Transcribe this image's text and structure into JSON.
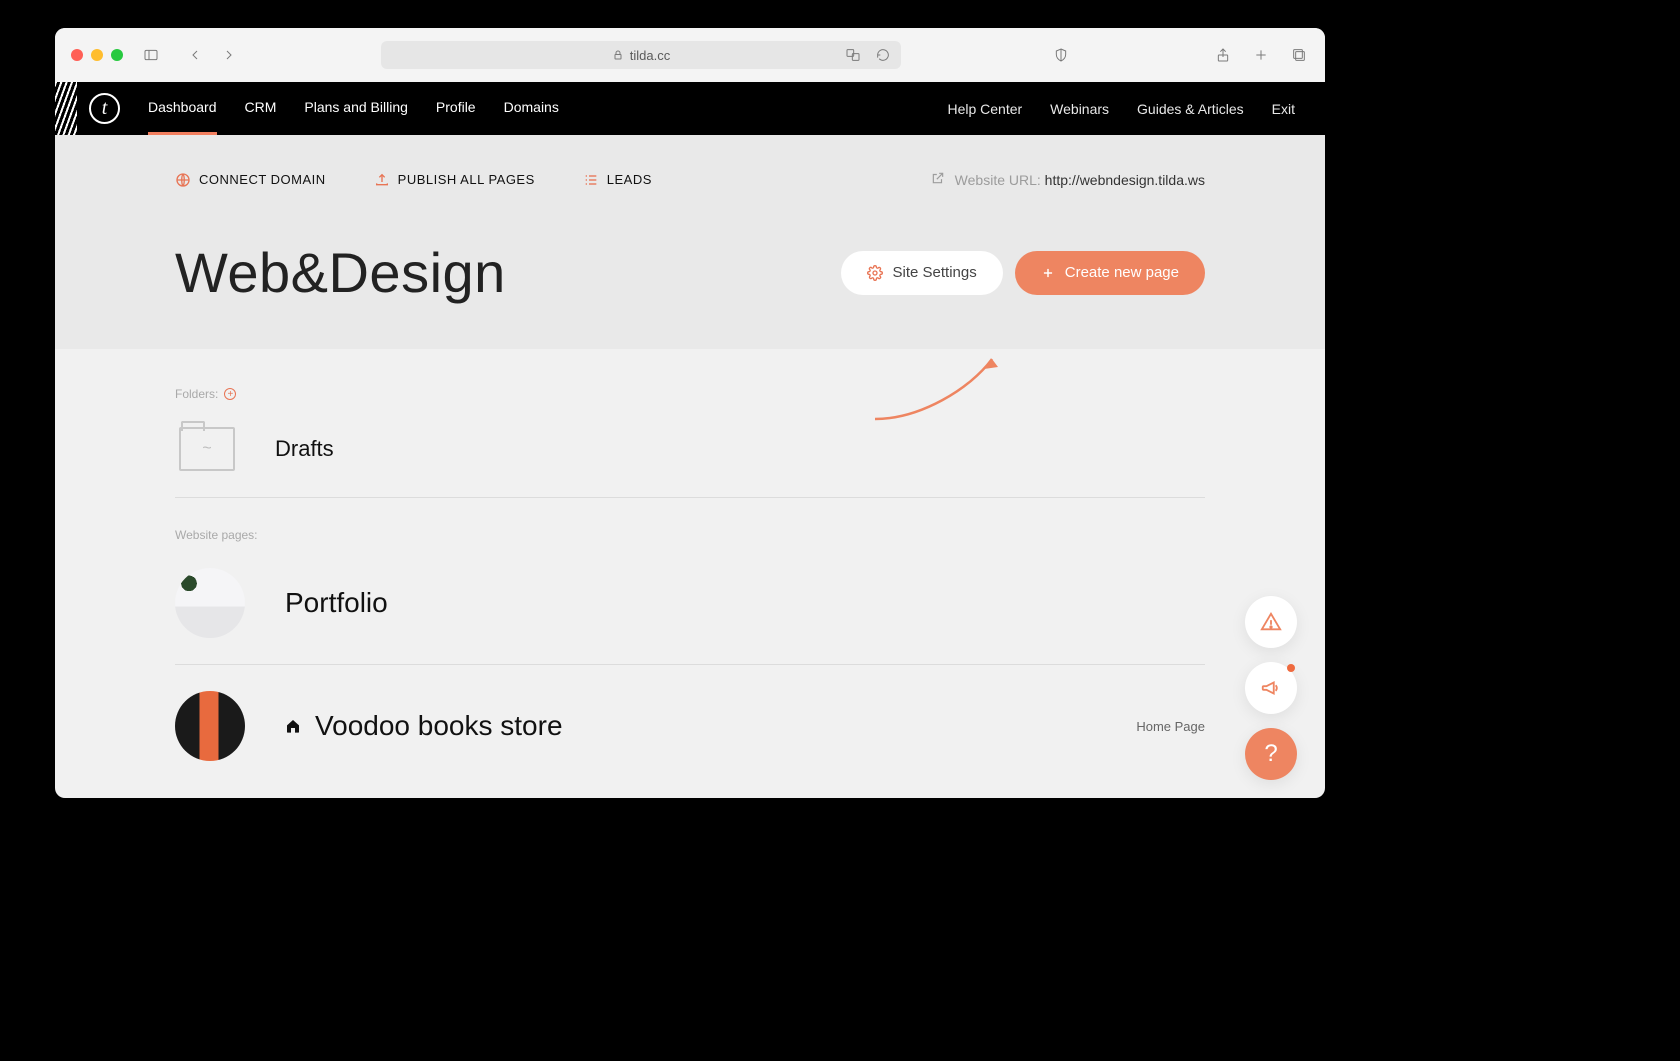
{
  "browser": {
    "url_display": "tilda.cc"
  },
  "nav": {
    "primary": [
      "Dashboard",
      "CRM",
      "Plans and Billing",
      "Profile",
      "Domains"
    ],
    "secondary": [
      "Help Center",
      "Webinars",
      "Guides & Articles",
      "Exit"
    ]
  },
  "subheader": {
    "connect_domain": "CONNECT DOMAIN",
    "publish_all": "PUBLISH ALL PAGES",
    "leads": "LEADS",
    "url_label": "Website URL: ",
    "url_value": "http://webndesign.tilda.ws"
  },
  "site": {
    "title": "Web&Design",
    "settings_btn": "Site Settings",
    "create_btn": "Create new page"
  },
  "folders": {
    "label": "Folders:",
    "drafts": "Drafts"
  },
  "pages_section": {
    "label": "Website pages:",
    "items": [
      {
        "title": "Portfolio"
      },
      {
        "title": "Voodoo books store",
        "home_tag": "Home Page"
      }
    ]
  },
  "floating": {
    "help_symbol": "?"
  }
}
